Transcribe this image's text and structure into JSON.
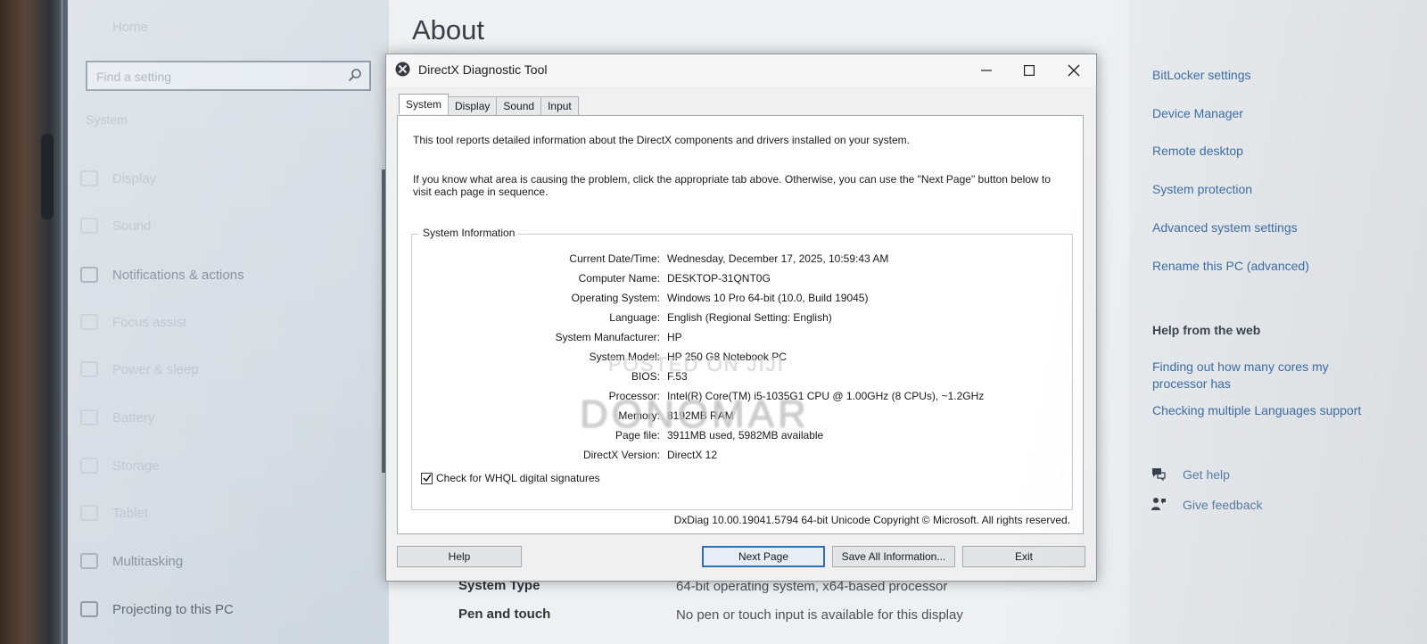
{
  "settings": {
    "home_label": "Home",
    "search_placeholder": "Find a setting",
    "section_label": "System",
    "nav": [
      {
        "label": "Display"
      },
      {
        "label": "Sound"
      },
      {
        "label": "Notifications & actions"
      },
      {
        "label": "Focus assist"
      },
      {
        "label": "Power & sleep"
      },
      {
        "label": "Battery"
      },
      {
        "label": "Storage"
      },
      {
        "label": "Tablet"
      },
      {
        "label": "Multitasking"
      },
      {
        "label": "Projecting to this PC"
      }
    ],
    "page_title": "About",
    "related": [
      {
        "label": "BitLocker settings"
      },
      {
        "label": "Device Manager"
      },
      {
        "label": "Remote desktop"
      },
      {
        "label": "System protection"
      },
      {
        "label": "Advanced system settings"
      },
      {
        "label": "Rename this PC (advanced)"
      }
    ],
    "help_heading": "Help from the web",
    "help_links": [
      {
        "label": "Finding out how many cores my processor has"
      },
      {
        "label": "Checking multiple Languages support"
      }
    ],
    "get_help": "Get help",
    "give_feedback": "Give feedback",
    "specs": [
      {
        "label": "System Type",
        "value": "64-bit operating system, x64-based processor"
      },
      {
        "label": "Pen and touch",
        "value": "No pen or touch input is available for this display"
      }
    ]
  },
  "dxdiag": {
    "title": "DirectX Diagnostic Tool",
    "tabs": [
      {
        "label": "System",
        "active": true
      },
      {
        "label": "Display",
        "active": false
      },
      {
        "label": "Sound",
        "active": false
      },
      {
        "label": "Input",
        "active": false
      }
    ],
    "intro_line1": "This tool reports detailed information about the DirectX components and drivers installed on your system.",
    "intro_line2": "If you know what area is causing the problem, click the appropriate tab above.  Otherwise, you can use the \"Next Page\" button below to visit each page in sequence.",
    "group_title": "System Information",
    "info": [
      {
        "label": "Current Date/Time:",
        "value": "Wednesday, December 17, 2025, 10:59:43 AM"
      },
      {
        "label": "Computer Name:",
        "value": "DESKTOP-31QNT0G"
      },
      {
        "label": "Operating System:",
        "value": "Windows 10 Pro 64-bit (10.0, Build 19045)"
      },
      {
        "label": "Language:",
        "value": "English (Regional Setting: English)"
      },
      {
        "label": "System Manufacturer:",
        "value": "HP"
      },
      {
        "label": "System Model:",
        "value": "HP 250 G8 Notebook PC"
      },
      {
        "label": "BIOS:",
        "value": "F.53"
      },
      {
        "label": "Processor:",
        "value": "Intel(R) Core(TM) i5-1035G1 CPU @ 1.00GHz (8 CPUs), ~1.2GHz"
      },
      {
        "label": "Memory:",
        "value": "8192MB RAM"
      },
      {
        "label": "Page file:",
        "value": "3911MB used, 5982MB available"
      },
      {
        "label": "DirectX Version:",
        "value": "DirectX 12"
      }
    ],
    "whql_label": "Check for WHQL digital signatures",
    "whql_checked": true,
    "copyright": "DxDiag 10.00.19041.5794 64-bit Unicode  Copyright © Microsoft. All rights reserved.",
    "buttons": {
      "help": "Help",
      "next": "Next Page",
      "save": "Save All Information...",
      "exit": "Exit"
    }
  },
  "watermark": {
    "line1": "POSTED ON JIJI",
    "line2": "DONOMAR"
  }
}
